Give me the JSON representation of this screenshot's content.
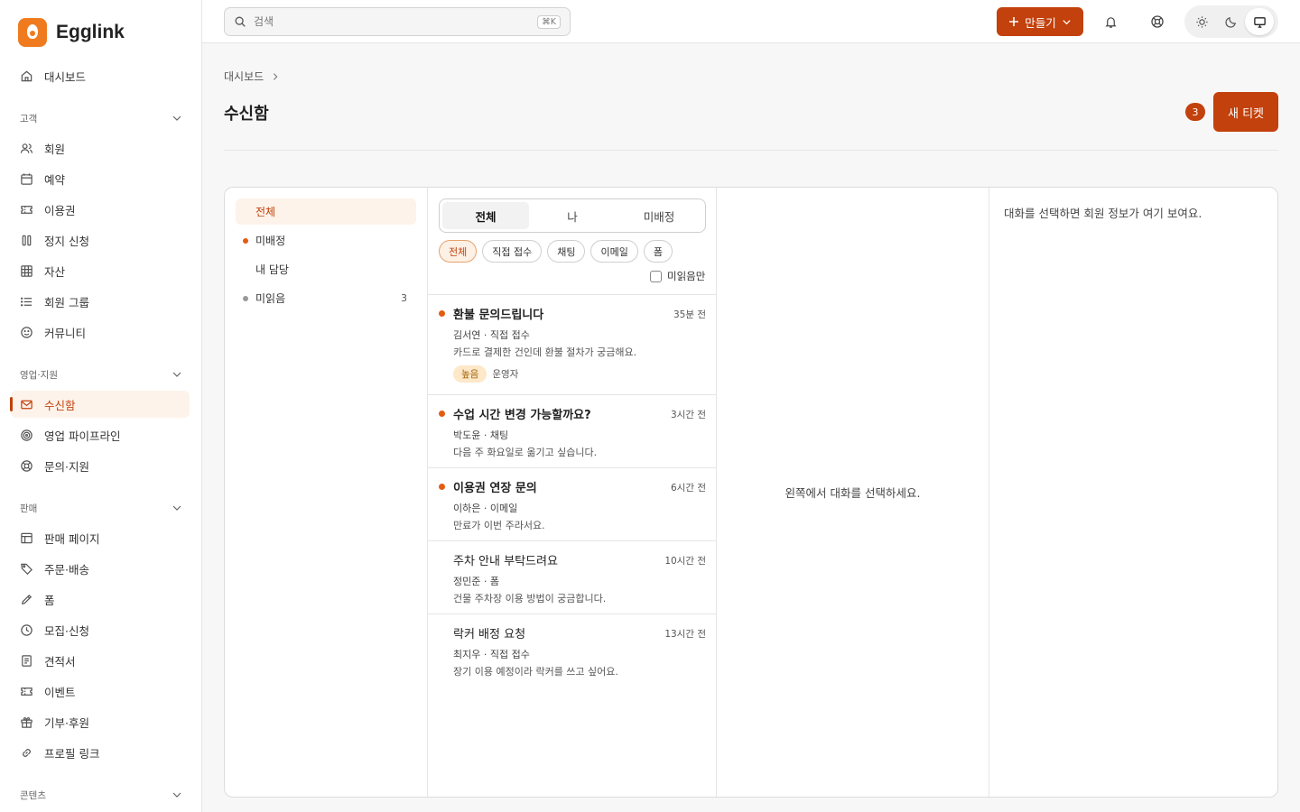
{
  "app": {
    "name": "Egglink"
  },
  "sidebar": {
    "dashboard": "대시보드",
    "sections": {
      "customers": "고객",
      "sales_support": "영업·지원",
      "sales": "판매",
      "content": "콘텐츠"
    },
    "customers": [
      "회원",
      "예약",
      "이용권",
      "정지 신청",
      "자산",
      "회원 그룹",
      "커뮤니티"
    ],
    "sales_support": [
      "수신함",
      "영업 파이프라인",
      "문의·지원"
    ],
    "sales": [
      "판매 페이지",
      "주문·배송",
      "폼",
      "모집·신청",
      "견적서",
      "이벤트",
      "기부·후원",
      "프로필 링크"
    ]
  },
  "topbar": {
    "search_placeholder": "검색",
    "shortcut": "⌘K",
    "create_label": "만들기"
  },
  "header": {
    "breadcrumb": "대시보드",
    "title": "수신함",
    "count": "3",
    "new_ticket": "새 티켓"
  },
  "folders": [
    {
      "label": "전체",
      "count": ""
    },
    {
      "label": "미배정",
      "count": ""
    },
    {
      "label": "내 담당",
      "count": ""
    },
    {
      "label": "미읽음",
      "count": "3"
    }
  ],
  "segments": [
    "전체",
    "나",
    "미배정"
  ],
  "channels": [
    "전체",
    "직접 접수",
    "채팅",
    "이메일",
    "폼"
  ],
  "unread_only": "미읽음만",
  "conversations": [
    {
      "subject": "환불 문의드립니다",
      "time": "35분 전",
      "meta": "김서연 · 직접 접수",
      "preview": "카드로 결제한 건인데 환불 절차가 궁금해요.",
      "priority": "높음",
      "assignee": "운영자"
    },
    {
      "subject": "수업 시간 변경 가능할까요?",
      "time": "3시간 전",
      "meta": "박도윤 · 채팅",
      "preview": "다음 주 화요일로 옮기고 싶습니다."
    },
    {
      "subject": "이용권 연장 문의",
      "time": "6시간 전",
      "meta": "이하은 · 이메일",
      "preview": "만료가 이번 주라서요."
    },
    {
      "subject": "주차 안내 부탁드려요",
      "time": "10시간 전",
      "meta": "정민준 · 폼",
      "preview": "건물 주차장 이용 방법이 궁금합니다."
    },
    {
      "subject": "락커 배정 요청",
      "time": "13시간 전",
      "meta": "최지우 · 직접 접수",
      "preview": "장기 이용 예정이라 락커를 쓰고 싶어요."
    }
  ],
  "detail_empty": "왼쪽에서 대화를 선택하세요.",
  "info_empty": "대화를 선택하면 회원 정보가 여기 보여요.",
  "colors": {
    "accent": "#c2410c",
    "unread_dot": "#e25c12",
    "logo": "#f07b1f"
  }
}
